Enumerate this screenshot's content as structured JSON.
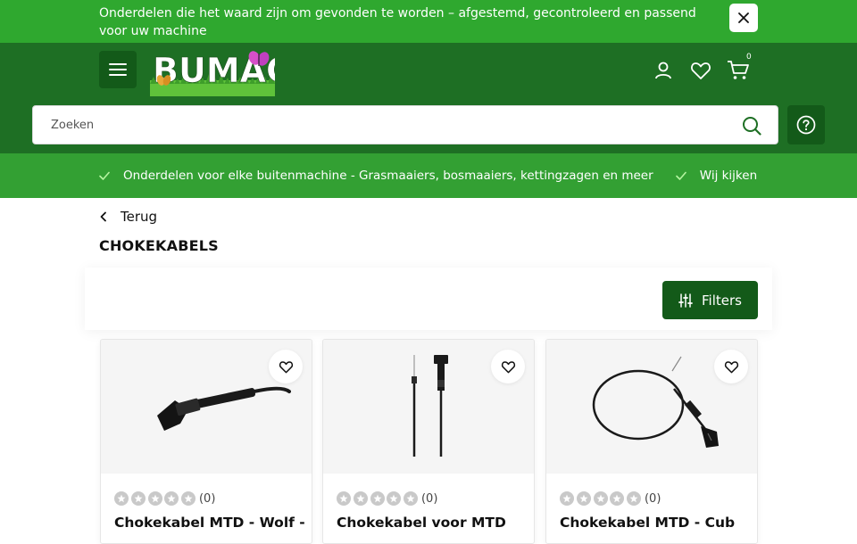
{
  "announcement": {
    "text": "Onderdelen die het waard zijn om gevonden te worden – afgestemd, gecontroleerd en passend voor uw machine"
  },
  "header": {
    "logo_text": "BUMAC",
    "cart_count": "0",
    "colors": {
      "header_bg": "#1e6f24",
      "topbar_bg": "#2fa82f",
      "usp_bg": "#33a033",
      "accent_dark": "#135a19"
    },
    "icons": [
      "menu-icon",
      "account-icon",
      "heart-icon",
      "cart-icon",
      "help-icon"
    ]
  },
  "search": {
    "placeholder": "Zoeken"
  },
  "usps": [
    {
      "text": "Onderdelen voor elke buitenmachine - Grasmaaiers, bosmaaiers, kettingzagen en meer"
    },
    {
      "text": "Wij kijken met u m"
    }
  ],
  "page": {
    "back_label": "Terug",
    "title": "CHOKEKABELS",
    "filter_label": "Filters"
  },
  "products": [
    {
      "title": "Chokekabel MTD - Wolf -",
      "rating_count": "(0)",
      "stars": 0
    },
    {
      "title": "Chokekabel voor MTD",
      "rating_count": "(0)",
      "stars": 0
    },
    {
      "title": "Chokekabel MTD - Cub",
      "rating_count": "(0)",
      "stars": 0
    }
  ]
}
